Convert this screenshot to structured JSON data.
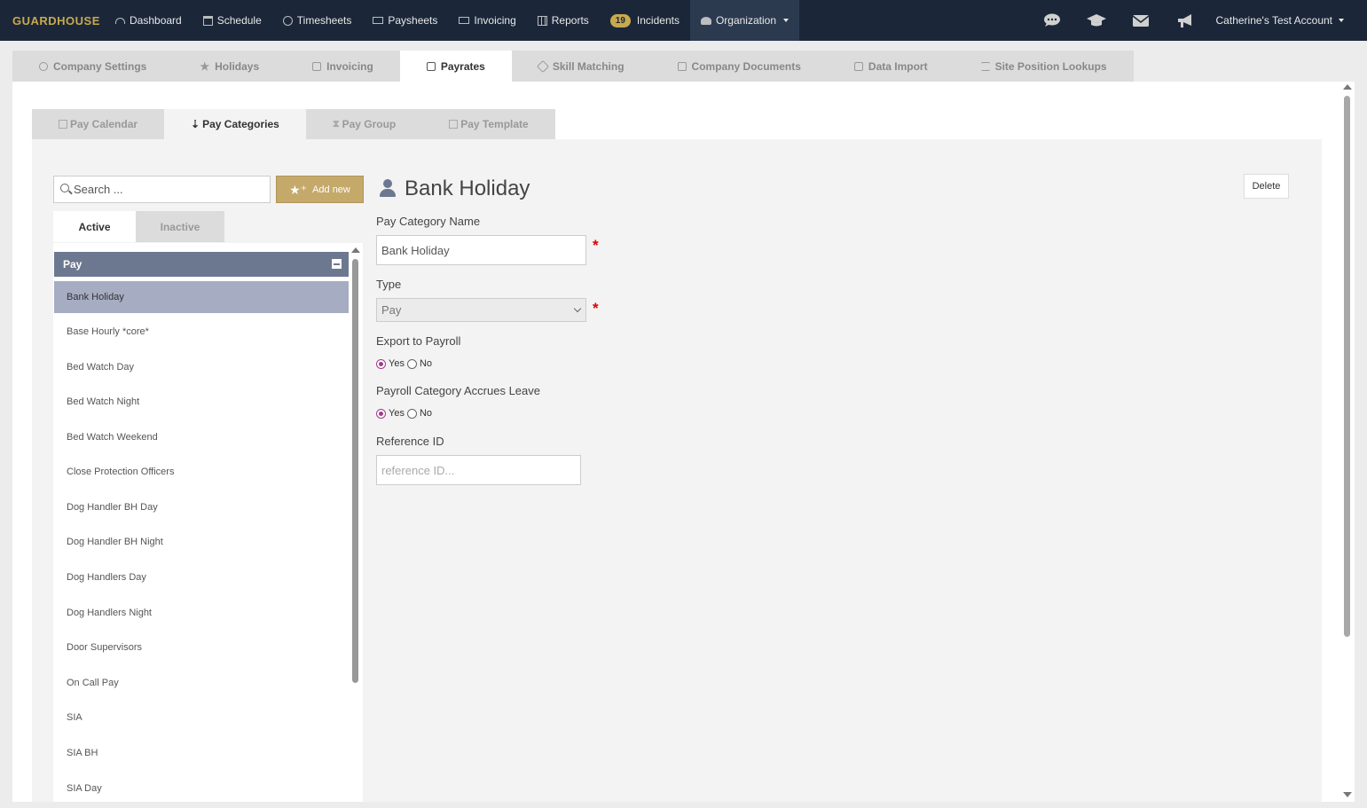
{
  "brand": "GUARDHOUSE",
  "nav": {
    "items": [
      {
        "label": "Dashboard",
        "icon": "dashboard-icon"
      },
      {
        "label": "Schedule",
        "icon": "calendar-icon"
      },
      {
        "label": "Timesheets",
        "icon": "clock-icon"
      },
      {
        "label": "Paysheets",
        "icon": "money-icon"
      },
      {
        "label": "Invoicing",
        "icon": "invoice-icon"
      },
      {
        "label": "Reports",
        "icon": "table-icon"
      }
    ],
    "incidents_count": "19",
    "incidents_label": "Incidents",
    "organization_label": "Organization",
    "account_label": "Catherine's Test Account"
  },
  "settings_tabs": [
    "Company Settings",
    "Holidays",
    "Invoicing",
    "Payrates",
    "Skill Matching",
    "Company Documents",
    "Data Import",
    "Site Position Lookups"
  ],
  "sub_tabs": [
    "Pay Calendar",
    "Pay Categories",
    "Pay Group",
    "Pay Template"
  ],
  "sidebar": {
    "search_placeholder": "Search ...",
    "add_new_label": "Add new",
    "status_tabs": [
      "Active",
      "Inactive"
    ],
    "group_label": "Pay",
    "items": [
      "Bank Holiday",
      "Base Hourly *core*",
      "Bed Watch Day",
      "Bed Watch Night",
      "Bed Watch Weekend",
      "Close Protection Officers",
      "Dog Handler BH Day",
      "Dog Handler BH Night",
      "Dog Handlers Day",
      "Dog Handlers Night",
      "Door Supervisors",
      "On Call Pay",
      "SIA",
      "SIA BH",
      "SIA Day"
    ],
    "selected_index": 0
  },
  "form": {
    "title": "Bank Holiday",
    "delete_label": "Delete",
    "name_label": "Pay Category Name",
    "name_value": "Bank Holiday",
    "type_label": "Type",
    "type_value": "Pay",
    "export_label": "Export to Payroll",
    "accrues_label": "Payroll Category Accrues Leave",
    "yes_label": "Yes",
    "no_label": "No",
    "export_value": "Yes",
    "accrues_value": "Yes",
    "reference_label": "Reference ID",
    "reference_placeholder": "reference ID..."
  },
  "colors": {
    "navbar": "#1b2739",
    "brand": "#c8a94e",
    "group_header": "#6c7890",
    "selected_item": "#a6acc2",
    "add_button": "#c5a96a",
    "required": "#dd0000",
    "radio_checked": "#a03c8c"
  }
}
